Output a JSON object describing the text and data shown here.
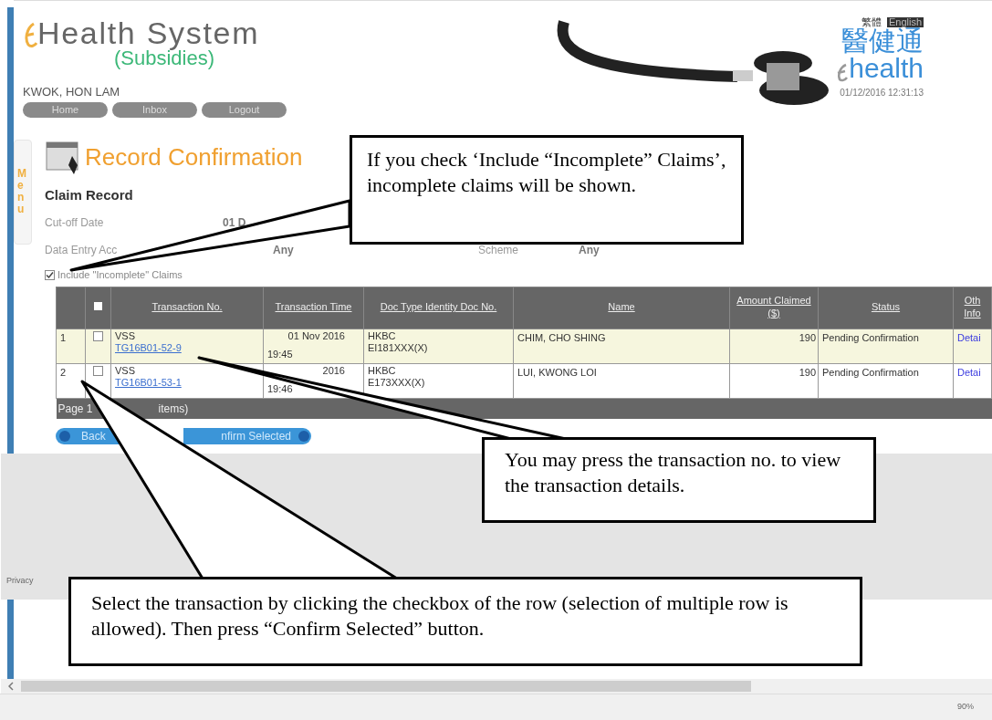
{
  "header": {
    "title": "Health System",
    "subtitle": "(Subsidies)",
    "user": "KWOK, HON LAM",
    "nav": [
      "Home",
      "Inbox",
      "Logout"
    ],
    "languages": [
      {
        "label": "繁體",
        "selected": false
      },
      {
        "label": "English",
        "selected": true
      }
    ],
    "brand_chinese": "醫健通",
    "brand": "health",
    "datetime": "01/12/2016 12:31:13"
  },
  "side_tab": "Menu",
  "page_title": "Record Confirmation",
  "section_title": "Claim Record",
  "fields": [
    {
      "label": "Cut-off Date",
      "value": "01 D"
    },
    {
      "label": "Data Entry Acc",
      "value": "Any",
      "label2": "Scheme",
      "value2": "Any"
    }
  ],
  "include_incomplete": {
    "label": "Include \"Incomplete\" Claims",
    "checked": true
  },
  "table": {
    "columns": [
      "",
      "",
      "Transaction No.",
      "Transaction Time",
      "Doc Type Identity Doc No.",
      "Name",
      "Amount Claimed ($)",
      "Status",
      "Oth Info"
    ],
    "rows": [
      {
        "index": "1",
        "checked": false,
        "scheme": "VSS",
        "transaction_no": "TG16B01-52-9",
        "time": "01 Nov 2016",
        "time2": "19:45",
        "doc_type": "HKBC",
        "doc_no": "EI181XXX(X)",
        "name": "CHIM, CHO SHING",
        "amount": "190",
        "status": "Pending Confirmation",
        "link": "Detai",
        "highlighted": true
      },
      {
        "index": "2",
        "checked": false,
        "scheme": "VSS",
        "transaction_no": "TG16B01-53-1",
        "time": "2016",
        "time2": "19:46",
        "doc_type": "HKBC",
        "doc_no": "E173XXX(X)",
        "name": "LUI, KWONG LOI",
        "amount": "190",
        "status": "Pending Confirmation",
        "link": "Detai",
        "highlighted": false
      }
    ],
    "footer": [
      "Page 1",
      "items)"
    ]
  },
  "buttons": [
    "Back",
    "nfirm Selected"
  ],
  "privacy": "Privacy",
  "zoom": "90%",
  "callouts": [
    {
      "text": "If you check ‘Include “Incomplete” Claims’, incomplete claims will be shown."
    },
    {
      "text": "You may press the transaction no. to view the transaction details."
    },
    {
      "text": "Select the transaction by clicking the checkbox of the row (selection of multiple row is allowed). Then press “Confirm Selected” button."
    }
  ]
}
